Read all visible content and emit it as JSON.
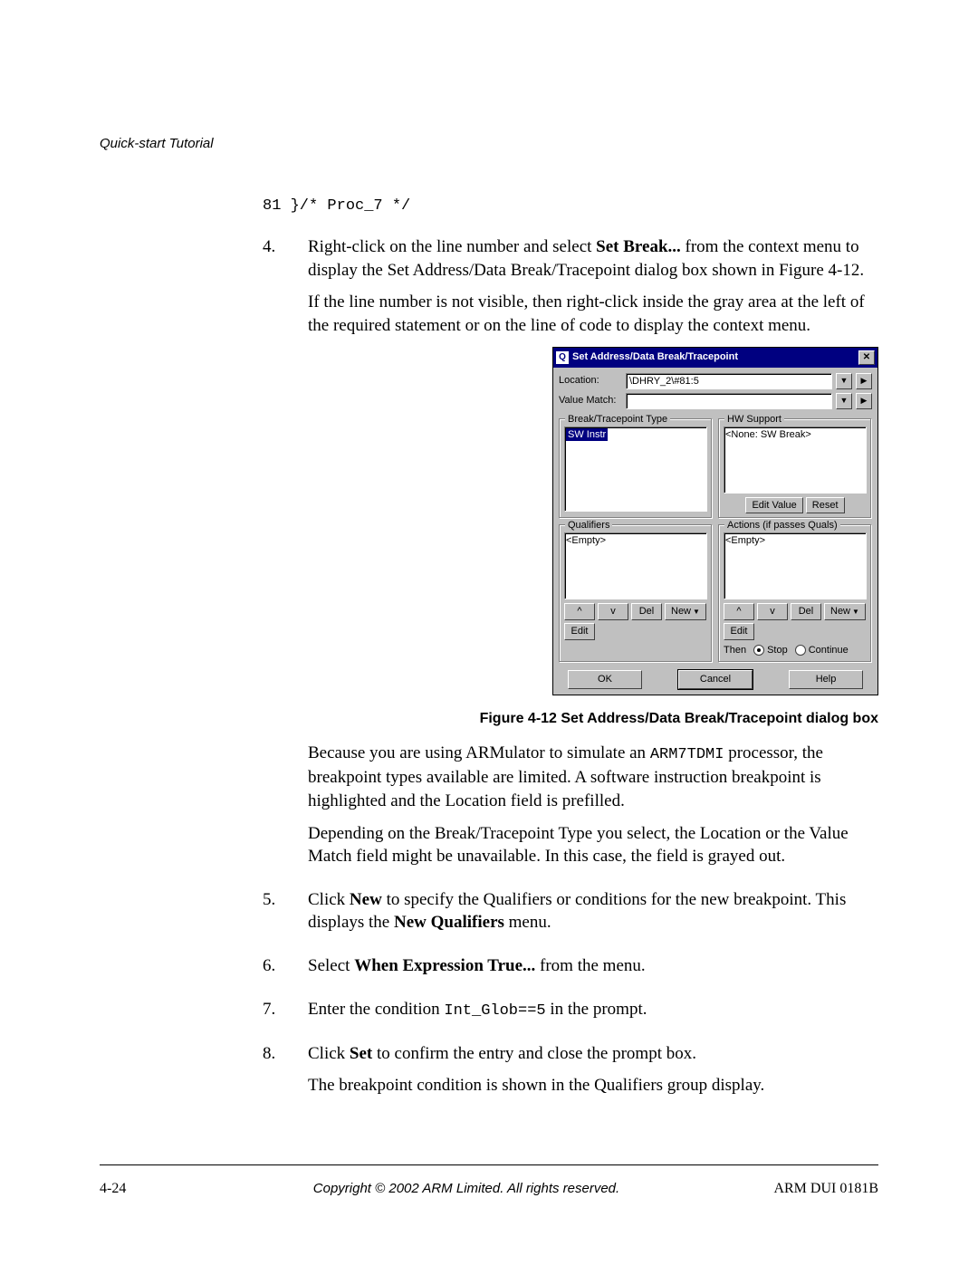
{
  "header": {
    "section": "Quick-start Tutorial"
  },
  "code_line": "81 }/* Proc_7 */",
  "steps": {
    "s4": {
      "num": "4.",
      "p1a": "Right-click on the line number and select ",
      "p1b": "Set Break...",
      "p1c": " from the context menu to display the Set Address/Data Break/Tracepoint dialog box shown in Figure 4-12.",
      "p2": "If the line number is not visible, then right-click inside the gray area at the left of the required statement or on the line of code to display the context menu."
    },
    "after_fig": {
      "p1a": "Because you are using ARMulator to simulate an ",
      "p1code": "ARM7TDMI",
      "p1b": " processor, the breakpoint types available are limited. A software instruction breakpoint is highlighted and the Location field is prefilled.",
      "p2": "Depending on the Break/Tracepoint Type you select, the Location or the Value Match field might be unavailable. In this case, the field is grayed out."
    },
    "s5": {
      "num": "5.",
      "a": "Click ",
      "b": "New",
      "c": " to specify the Qualifiers or conditions for the new breakpoint. This displays the ",
      "d": "New Qualifiers",
      "e": " menu."
    },
    "s6": {
      "num": "6.",
      "a": "Select ",
      "b": "When Expression True...",
      "c": " from the menu."
    },
    "s7": {
      "num": "7.",
      "a": "Enter the condition ",
      "code": "Int_Glob==5",
      "b": " in the prompt."
    },
    "s8": {
      "num": "8.",
      "a": "Click ",
      "b": "Set",
      "c": " to confirm the entry and close the prompt box.",
      "p2": "The breakpoint condition is shown in the Qualifiers group display."
    }
  },
  "dialog": {
    "title": "Set Address/Data Break/Tracepoint",
    "icon_letter": "Q",
    "close": "✕",
    "location_label": "Location:",
    "location_value": "\\DHRY_2\\#81:5",
    "valuematch_label": "Value Match:",
    "valuematch_value": "",
    "group_bt": "Break/Tracepoint Type",
    "bt_item": "SW Instr",
    "group_hw": "HW Support",
    "hw_item": "<None: SW Break>",
    "editvalue": "Edit Value",
    "reset": "Reset",
    "group_quals": "Qualifiers",
    "quals_item": "<Empty>",
    "group_actions": "Actions (if passes Quals)",
    "actions_item": "<Empty>",
    "up": "^",
    "down": "v",
    "del": "Del",
    "new": "New",
    "edit": "Edit",
    "then": "Then",
    "stop": "Stop",
    "continue": "Continue",
    "ok": "OK",
    "cancel": "Cancel",
    "help": "Help",
    "caret": "▼",
    "arrow_right": "▶"
  },
  "figure_caption": "Figure 4-12 Set Address/Data Break/Tracepoint dialog box",
  "footer": {
    "page": "4-24",
    "copyright": "Copyright © 2002 ARM Limited. All rights reserved.",
    "docid": "ARM DUI 0181B"
  }
}
